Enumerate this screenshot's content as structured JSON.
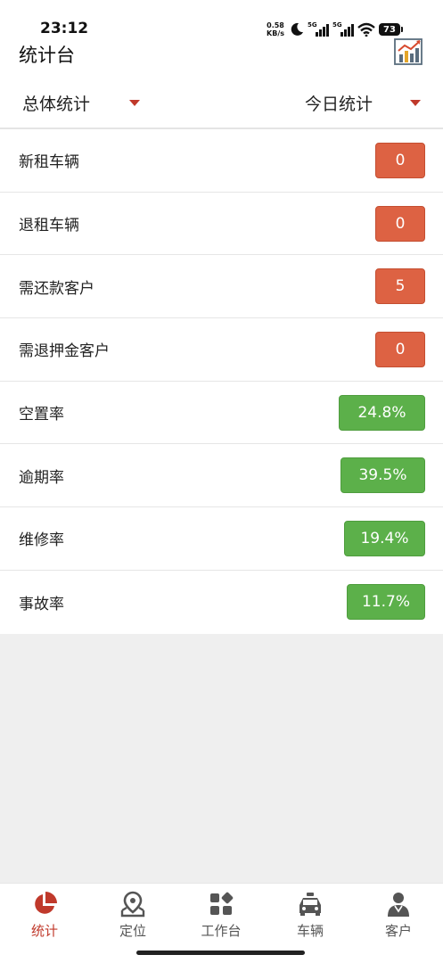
{
  "status_bar": {
    "time": "23:12",
    "net_speed_value": "0.58",
    "net_speed_unit": "KB/s",
    "sim1_label": "5G",
    "sim2_label": "5G",
    "battery": "73"
  },
  "header": {
    "title": "统计台",
    "chart_icon": "chart-report-icon"
  },
  "filters": {
    "left_label": "总体统计",
    "right_label": "今日统计"
  },
  "stats": [
    {
      "label": "新租车辆",
      "value": "0",
      "color": "red"
    },
    {
      "label": "退租车辆",
      "value": "0",
      "color": "red"
    },
    {
      "label": "需还款客户",
      "value": "5",
      "color": "red"
    },
    {
      "label": "需退押金客户",
      "value": "0",
      "color": "red"
    },
    {
      "label": "空置率",
      "value": "24.8%",
      "color": "green"
    },
    {
      "label": "逾期率",
      "value": "39.5%",
      "color": "green"
    },
    {
      "label": "维修率",
      "value": "19.4%",
      "color": "green"
    },
    {
      "label": "事故率",
      "value": "11.7%",
      "color": "green"
    }
  ],
  "colors": {
    "accent": "#c0392b",
    "badge_red": "#dd6243",
    "badge_green": "#5cb04a"
  },
  "nav": [
    {
      "label": "统计",
      "icon": "pie-chart-icon",
      "active": true
    },
    {
      "label": "定位",
      "icon": "location-pin-icon",
      "active": false
    },
    {
      "label": "工作台",
      "icon": "apps-grid-icon",
      "active": false
    },
    {
      "label": "车辆",
      "icon": "car-icon",
      "active": false
    },
    {
      "label": "客户",
      "icon": "person-icon",
      "active": false
    }
  ]
}
